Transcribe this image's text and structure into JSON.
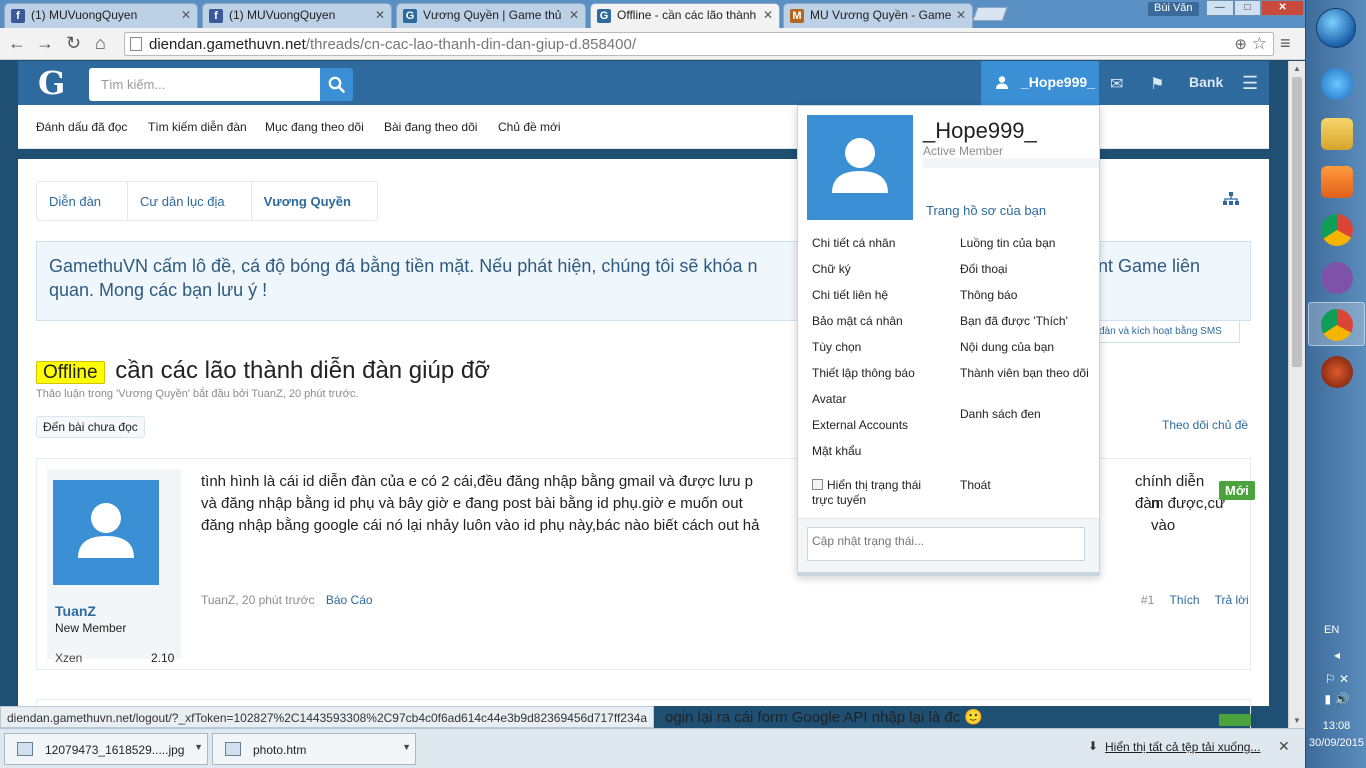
{
  "browser": {
    "tabs": [
      {
        "title": "(1) MUVuongQuyen",
        "favicon": "facebook-icon",
        "favicon_letter": "f",
        "favicon_color": "#3b5998"
      },
      {
        "title": "(1) MUVuongQuyen",
        "favicon": "facebook-icon",
        "favicon_letter": "f",
        "favicon_color": "#3b5998"
      },
      {
        "title": "Vương Quyền | Game thủ",
        "favicon": "gamethuvn-icon",
        "favicon_letter": "G",
        "favicon_color": "#2e6a9e"
      },
      {
        "title": "Offline - cần các lão thành",
        "favicon": "gamethuvn-icon",
        "favicon_letter": "G",
        "favicon_color": "#2e6a9e"
      },
      {
        "title": "MU Vương Quyền - Game",
        "favicon": "mu-icon",
        "favicon_letter": "M",
        "favicon_color": "#b5651d"
      }
    ],
    "user_badge": "Bùi Văn",
    "url_host": "diendan.gamethuvn.net",
    "url_path": "/threads/cn-cac-lao-thanh-din-dan-giup-d.858400/"
  },
  "site": {
    "logo": "G",
    "search_placeholder": "Tìm kiếm...",
    "username": "_Hope999_",
    "bank": "Bank",
    "subnav": [
      "Đánh dấu đã đọc",
      "Tìm kiếm diễn đàn",
      "Mục đang theo dõi",
      "Bài đang theo dõi",
      "Chủ đề mới"
    ]
  },
  "breadcrumb": [
    "Diễn đàn",
    "Cư dân lục địa",
    "Vương Quyền"
  ],
  "notice": {
    "line1": "GamethuVN cấm lô đề, cá độ bóng đá bằng tiền mặt. Nếu phát hiện, chúng tôi sẽ khóa n",
    "line1_end": "ccount Game liên",
    "line2": "quan. Mong các bạn lưu ý !",
    "sms_link": "đàn và kích hoạt bằng SMS"
  },
  "thread": {
    "prefix": "Offline",
    "title": "cần các lão thành diễn đàn giúp đỡ",
    "meta": "Thảo luận trong 'Vương Quyền' bắt đầu bởi TuanZ, 20 phút trước.",
    "unread_button": "Đến bài chưa đọc",
    "watch": "Theo dõi chủ đề"
  },
  "post": {
    "username": "TuanZ",
    "user_title": "New Member",
    "xzen_label": "Xzen",
    "xzen_value": "2.10",
    "message_line1": "tình hình là cái id diễn đàn của e có 2 cái,đều đăng nhập bằng gmail và được lưu p",
    "message_line1_end": "chính diễn đàn",
    "message_line2": "và đăng nhập bằng id phụ và bây giờ e đang post bài bằng id phụ.giờ e muốn out",
    "message_line2_end": "m được,cứ vào",
    "message_line3": "đăng nhập bằng google cái nó lại nhảy luôn vào id phụ này,bác nào biết cách out hả",
    "new_badge": "Mới",
    "meta_author": "TuanZ, 20 phút trước",
    "report": "Báo Cáo",
    "post_number": "#1",
    "like": "Thích",
    "reply": "Trả lời"
  },
  "post2": {
    "text": "ogin lại ra cái form Google API nhập lại là đc 🙂"
  },
  "dropdown": {
    "name": "_Hope999_",
    "title": "Active Member",
    "profile_link": "Trang hồ sơ của bạn",
    "left_items": [
      "Chi tiết cá nhân",
      "Chữ ký",
      "Chi tiết liên hệ",
      "Bảo mật cá nhân",
      "Tùy chọn",
      "Thiết lập thông báo",
      "Avatar",
      "External Accounts",
      "Mật khẩu"
    ],
    "right_items": [
      "Luồng tin của bạn",
      "Đối thoại",
      "Thông báo",
      "Bạn đã được 'Thích'",
      "Nội dung của bạn",
      "Thành viên bạn theo dõi",
      "Danh sách đen"
    ],
    "status_toggle": "Hiển thị trạng thái trực tuyến",
    "logout": "Thoát",
    "status_placeholder": "Cập nhật trạng thái..."
  },
  "status_url": "diendan.gamethuvn.net/logout/?_xfToken=102827%2C1443593308%2C97cb4c0f6ad614c44e3b9d82369456d717ff234a",
  "downloads": {
    "items": [
      "12079473_1618529.....jpg",
      "photo.htm"
    ],
    "show_all": "Hiển thị tất cả tệp tải xuống..."
  },
  "taskbar": {
    "lang": "EN",
    "time": "13:08",
    "date": "30/09/2015"
  },
  "colors": {
    "header_blue": "#2e6a9e",
    "accent_blue": "#3b8fd4",
    "prefix_yellow": "#ffff00",
    "new_green": "#4ba43b"
  }
}
